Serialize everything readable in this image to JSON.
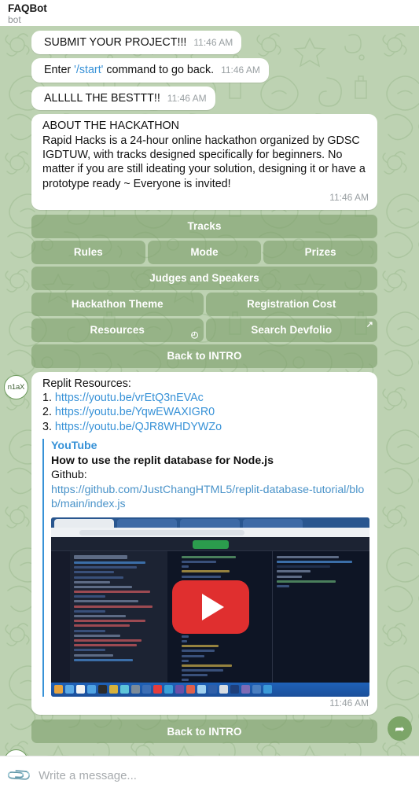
{
  "header": {
    "title": "FAQBot",
    "subtitle": "bot"
  },
  "messages": [
    {
      "text": "SUBMIT YOUR PROJECT!!!",
      "time": "11:46 AM"
    },
    {
      "text_before": "Enter ",
      "command": "'/start'",
      "text_after": " command to go back.",
      "time": "11:46 AM"
    },
    {
      "text": "ALLLLL THE BESTTT!!",
      "time": "11:46 AM"
    }
  ],
  "about": {
    "title": "ABOUT THE HACKATHON",
    "body": "Rapid Hacks is a 24-hour online hackathon organized by GDSC IGDTUW, with tracks designed specifically for beginners. No matter if you are still ideating your solution, designing it or have a prototype ready ~ Everyone is invited!",
    "time": "11:46 AM"
  },
  "keyboard": {
    "rows": [
      [
        {
          "label": "Tracks",
          "icon": ""
        }
      ],
      [
        {
          "label": "Rules",
          "icon": ""
        },
        {
          "label": "Mode",
          "icon": ""
        },
        {
          "label": "Prizes",
          "icon": ""
        }
      ],
      [
        {
          "label": "Judges and Speakers",
          "icon": ""
        }
      ],
      [
        {
          "label": "Hackathon Theme",
          "icon": ""
        },
        {
          "label": "Registration Cost",
          "icon": ""
        }
      ],
      [
        {
          "label": "Resources",
          "icon": "clock-icon"
        },
        {
          "label": "Search Devfolio",
          "icon": "external-link-icon"
        }
      ],
      [
        {
          "label": "Back to INTRO",
          "icon": ""
        }
      ]
    ],
    "clock_glyph": "◴",
    "extlink_glyph": "↗"
  },
  "resources_message": {
    "heading": "Replit Resources:",
    "links": [
      {
        "num": "1.",
        "url": "https://youtu.be/vrEtQ3nEVAc"
      },
      {
        "num": "2.",
        "url": "https://youtu.be/YqwEWAXIGR0"
      },
      {
        "num": "3.",
        "url": "https://youtu.be/QJR8WHDYWZo"
      }
    ],
    "preview": {
      "site": "YouTube",
      "title": "How to use the replit database for Node.js",
      "label": "Github:",
      "url": "https://github.com/JustChangHTML5/replit-database-tutorial/blob/main/index.js"
    },
    "time": "11:46 AM",
    "thumbnail_alt": "replit-ide-video-thumbnail"
  },
  "final_keyboard": {
    "rows": [
      [
        {
          "label": "Back to INTRO",
          "icon": ""
        }
      ]
    ]
  },
  "avatar": {
    "initials": "n1aX"
  },
  "forward": {
    "glyph": "➦"
  },
  "composer": {
    "attach_glyph": "📎",
    "placeholder": "Write a message...",
    "value": ""
  },
  "colors": {
    "chat_bg": "#bdd2b2",
    "button_green": "#7ea06c",
    "link_blue": "#3892d7",
    "play_red": "#e02f2f"
  }
}
